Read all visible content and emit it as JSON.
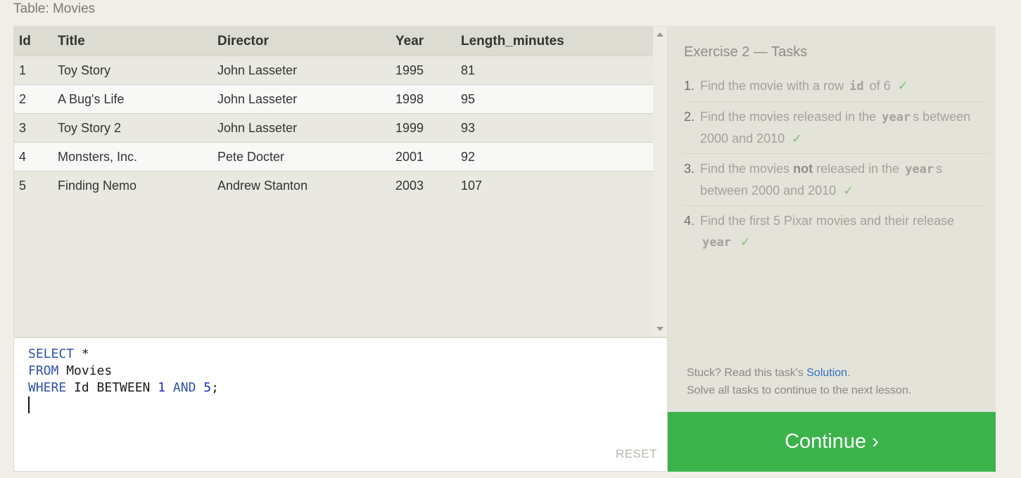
{
  "table_caption": "Table: Movies",
  "table": {
    "headers": [
      "Id",
      "Title",
      "Director",
      "Year",
      "Length_minutes"
    ],
    "rows": [
      [
        "1",
        "Toy Story",
        "John Lasseter",
        "1995",
        "81"
      ],
      [
        "2",
        "A Bug's Life",
        "John Lasseter",
        "1998",
        "95"
      ],
      [
        "3",
        "Toy Story 2",
        "John Lasseter",
        "1999",
        "93"
      ],
      [
        "4",
        "Monsters, Inc.",
        "Pete Docter",
        "2001",
        "92"
      ],
      [
        "5",
        "Finding Nemo",
        "Andrew Stanton",
        "2003",
        "107"
      ]
    ]
  },
  "editor": {
    "line1_kw": "SELECT",
    "line1_rest": " *",
    "line2_kw": "FROM",
    "line2_rest": " Movies",
    "line3_kw1": "WHERE",
    "line3_mid1": " Id BETWEEN ",
    "line3_num1": "1",
    "line3_kw2": " AND ",
    "line3_num2": "5",
    "line3_end": ";",
    "reset_label": "RESET"
  },
  "tasks": {
    "title": "Exercise 2 — Tasks",
    "items": [
      {
        "num": "1.",
        "pre": "Find the movie with a row",
        "code": "id",
        "post": "of 6",
        "check": "✓"
      },
      {
        "num": "2.",
        "pre": "Find the movies released in the",
        "code": "year",
        "post": "s between 2000 and 2010",
        "check": "✓"
      },
      {
        "num": "3.",
        "pre1": "Find the movies",
        "bold": "not",
        "pre2": "released in the",
        "code": "year",
        "post": "s between 2000 and 2010",
        "check": "✓"
      },
      {
        "num": "4.",
        "pre": "Find the first 5 Pixar movies and their release",
        "code": "year",
        "post": "",
        "check": "✓"
      }
    ],
    "help_prefix": "Stuck? Read this task's ",
    "help_link": "Solution",
    "help_suffix": ".",
    "help_line2": "Solve all tasks to continue to the next lesson."
  },
  "continue_label": "Continue ›",
  "colors": {
    "continue_bg": "#3bb34a",
    "link": "#2f6ec2",
    "check": "#7cc27a",
    "keyword": "#2e52a8"
  }
}
